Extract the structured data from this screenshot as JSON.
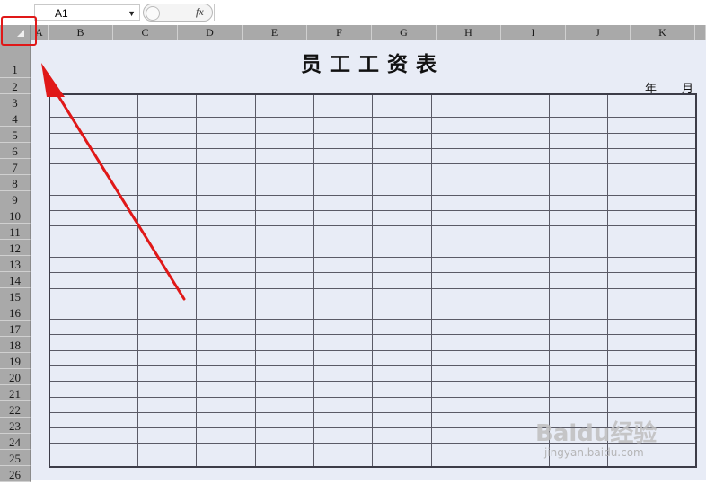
{
  "formula_bar": {
    "name_box_value": "A1",
    "fx_label": "fx",
    "formula_value": ""
  },
  "columns": [
    {
      "label": "A"
    },
    {
      "label": "B"
    },
    {
      "label": "C"
    },
    {
      "label": "D"
    },
    {
      "label": "E"
    },
    {
      "label": "F"
    },
    {
      "label": "G"
    },
    {
      "label": "H"
    },
    {
      "label": "I"
    },
    {
      "label": "J"
    },
    {
      "label": "K"
    }
  ],
  "rows": [
    "1",
    "2",
    "3",
    "4",
    "5",
    "6",
    "7",
    "8",
    "9",
    "10",
    "11",
    "12",
    "13",
    "14",
    "15",
    "16",
    "17",
    "18",
    "19",
    "20",
    "21",
    "22",
    "23",
    "24",
    "25",
    "26"
  ],
  "sheet": {
    "title": "员工工资表",
    "year_label": "年",
    "month_label": "月",
    "table_rows": 23,
    "table_cols": 10
  },
  "watermark": {
    "main": "Baidu经验",
    "sub": "jingyan.baidu.com"
  },
  "colors": {
    "header_bg": "#a9a9a9",
    "sheet_bg": "#e8ecf6",
    "annotation": "#e01818"
  },
  "icons": {
    "select_all": "triangle-select-all-icon",
    "name_box_dropdown": "dropdown-triangle-icon"
  }
}
